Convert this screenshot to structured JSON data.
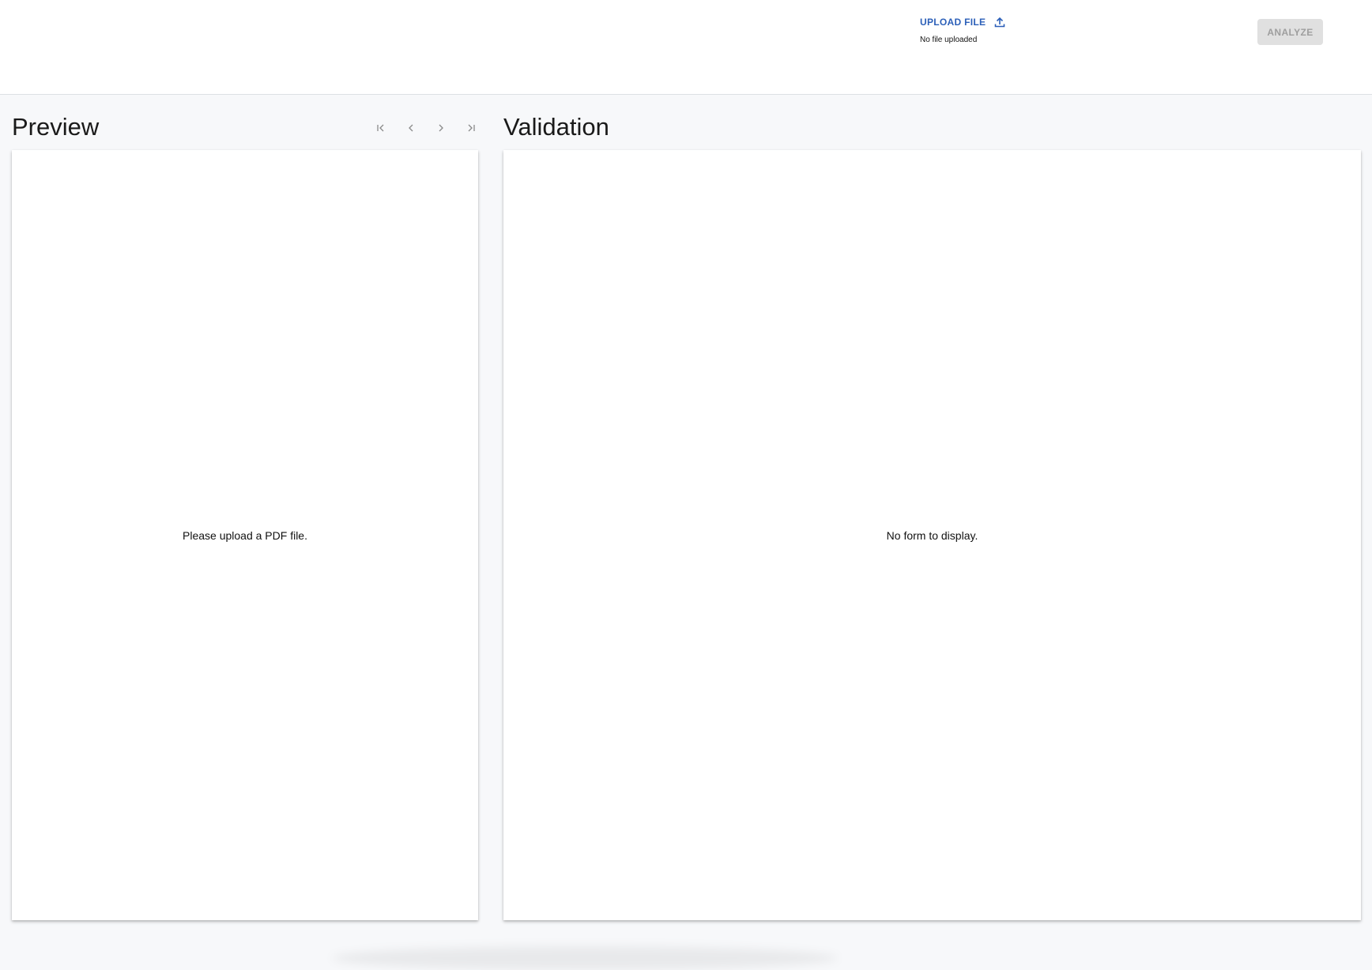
{
  "header": {
    "upload_label": "UPLOAD FILE",
    "file_status": "No file uploaded",
    "analyze_label": "ANALYZE",
    "upload_icon": "upload-icon"
  },
  "preview": {
    "title": "Preview",
    "empty_message": "Please upload a PDF file.",
    "pager_icons": [
      "first-page-icon",
      "prev-page-icon",
      "next-page-icon",
      "last-page-icon"
    ]
  },
  "validation": {
    "title": "Validation",
    "empty_message": "No form to display."
  },
  "colors": {
    "accent": "#2b5fb8",
    "disabled_bg": "#e0e0e0",
    "disabled_text": "#9e9e9e",
    "page_bg": "#f7f8fa"
  }
}
